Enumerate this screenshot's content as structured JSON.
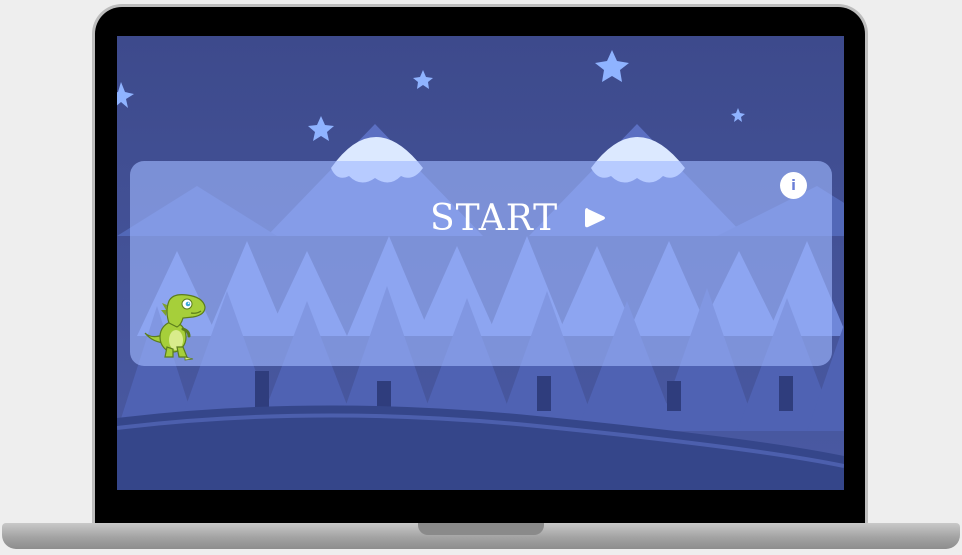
{
  "game": {
    "start_label": "START",
    "info_icon": "info-icon",
    "play_icon": "play-icon",
    "character": "dinosaur"
  },
  "colors": {
    "sky": "#3f4d8f",
    "panel": "#a0b8ff",
    "stars": "#8fb3ff",
    "snow": "#dce9ff",
    "mountains": "#5b6fc2",
    "trees_far": "#6f87d9",
    "trees_near": "#4f62b3",
    "ground": "#35468a",
    "dino": "#a6cf3a"
  }
}
